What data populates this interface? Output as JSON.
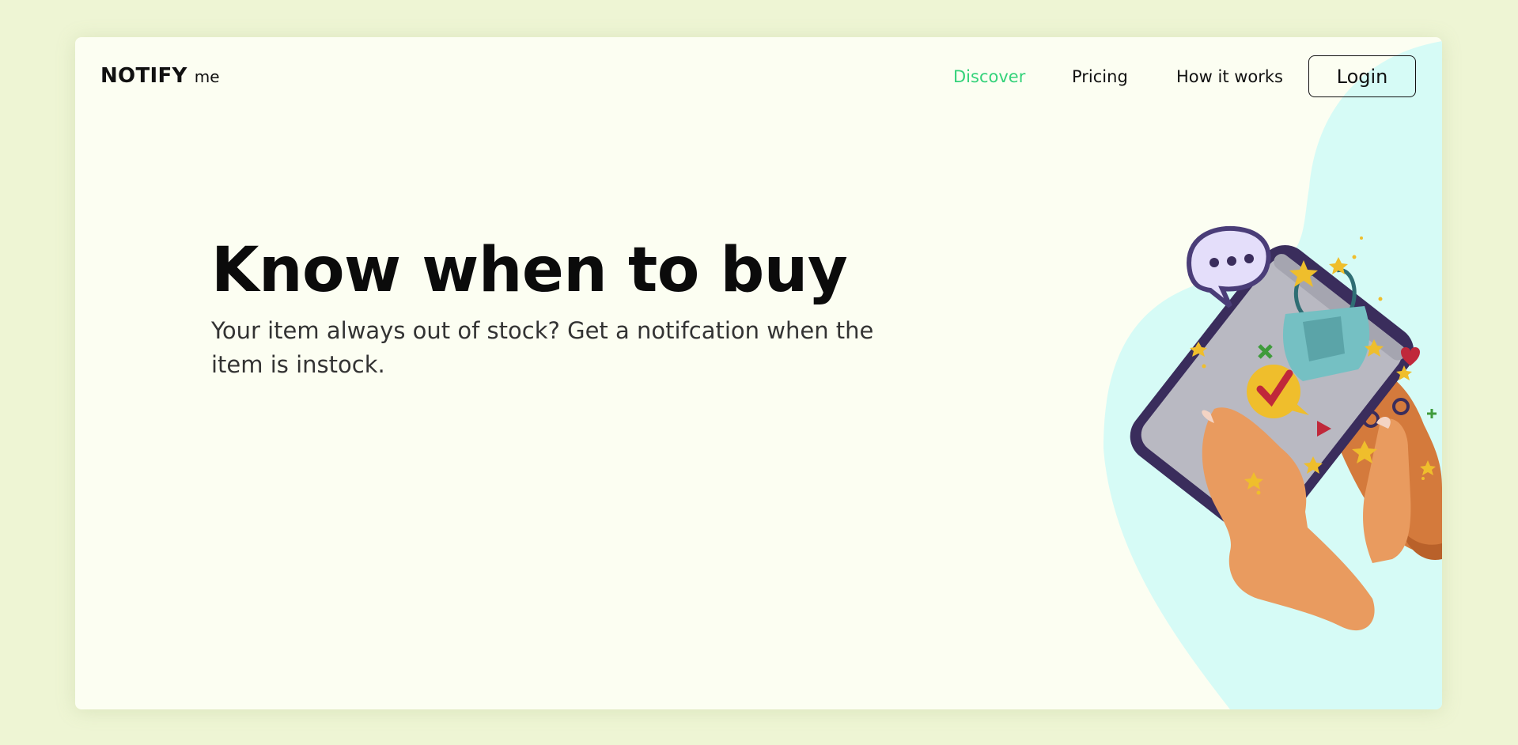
{
  "brand": {
    "name": "NOTIFY",
    "suffix": "me"
  },
  "nav": {
    "links": [
      {
        "label": "Discover",
        "active": true
      },
      {
        "label": "Pricing",
        "active": false
      },
      {
        "label": "How it works",
        "active": false
      }
    ],
    "login_label": "Login"
  },
  "hero": {
    "title": "Know when to buy",
    "subtitle": "Your item always out of stock? Get a notifcation when the item is instock."
  },
  "colors": {
    "page_background": "#eef5d4",
    "card_background": "#fcfef2",
    "accent_active": "#34d27a",
    "blob": "#d6fbf6"
  }
}
